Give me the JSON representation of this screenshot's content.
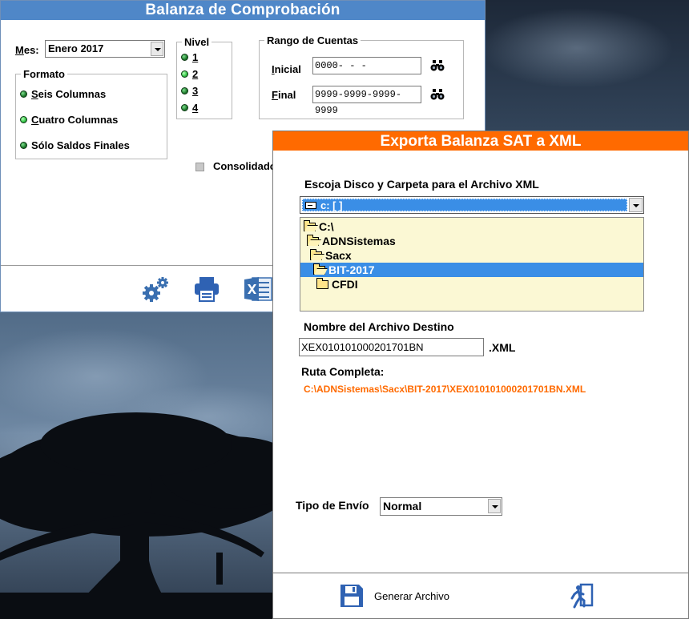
{
  "balanza": {
    "title": "Balanza de Comprobación",
    "mes_label": "Mes:",
    "mes_value": "Enero 2017",
    "formato": {
      "legend": "Formato",
      "options": [
        "Seis Columnas",
        "Cuatro Columnas",
        "Sólo Saldos Finales"
      ]
    },
    "nivel": {
      "legend": "Nivel",
      "options": [
        "1",
        "2",
        "3",
        "4"
      ]
    },
    "rango": {
      "legend": "Rango de Cuentas",
      "inicial_label": "Inicial",
      "inicial_value": "0000-   -   -",
      "final_label": "Final",
      "final_value": "9999-9999-9999-9999"
    },
    "consolidado_label": "Consolidado"
  },
  "exporta": {
    "title": "Exporta Balanza SAT a XML",
    "choose_label": "Escoja Disco y Carpeta para el Archivo XML",
    "drive_value": "c: [ ]",
    "directories": [
      {
        "name": "C:\\",
        "depth": 0,
        "open": true,
        "selected": false
      },
      {
        "name": "ADNSistemas",
        "depth": 1,
        "open": true,
        "selected": false
      },
      {
        "name": "Sacx",
        "depth": 2,
        "open": true,
        "selected": false
      },
      {
        "name": "BIT-2017",
        "depth": 3,
        "open": true,
        "selected": true
      },
      {
        "name": "CFDI",
        "depth": 4,
        "open": false,
        "selected": false
      }
    ],
    "nombre_label": "Nombre del Archivo Destino",
    "file_name": "XEX010101000201701BN",
    "extension": ".XML",
    "ruta_label": "Ruta Completa:",
    "ruta_value": "C:\\ADNSistemas\\Sacx\\BIT-2017\\XEX010101000201701BN.XML",
    "tipo_label": "Tipo de Envío",
    "tipo_value": "Normal",
    "generar_label": "Generar Archivo"
  },
  "colors": {
    "balanza_title_bg": "#4f87c8",
    "exporta_title_bg": "#ff6a00",
    "selection": "#3a8ee6",
    "path_text": "#ff6a00",
    "dir_list_bg": "#fbf8d4"
  },
  "icons": [
    "gears-icon",
    "printer-icon",
    "excel-icon",
    "binoculars-icon",
    "save-icon",
    "exit-icon"
  ]
}
